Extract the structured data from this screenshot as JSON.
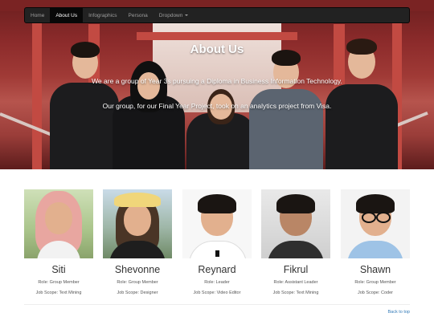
{
  "nav": {
    "items": [
      "Home",
      "About Us",
      "Infographics",
      "Persona",
      "Dropdown"
    ]
  },
  "hero": {
    "title": "About Us",
    "line1": "We are a group of Year 3s pursuing a Diploma in Business Information Technology.",
    "line2": "Our group, for our Final Year Project, took on an analytics project from Visa."
  },
  "members": [
    {
      "name": "Siti",
      "role": "Role: Group Member",
      "scope": "Job Scope: Text Mining"
    },
    {
      "name": "Shevonne",
      "role": "Role: Group Member",
      "scope": "Job Scope: Designer"
    },
    {
      "name": "Reynard",
      "role": "Role: Leader",
      "scope": "Job Scope: Video Editor"
    },
    {
      "name": "Fikrul",
      "role": "Role: Assistant Leader",
      "scope": "Job Scope: Text Mining"
    },
    {
      "name": "Shawn",
      "role": "Role: Group Member",
      "scope": "Job Scope: Coder"
    }
  ],
  "footer": {
    "back_to_top": "Back to top"
  },
  "colors": {
    "navbar": "#222222",
    "link": "#337ab7",
    "hero_red": "#a03a36"
  }
}
